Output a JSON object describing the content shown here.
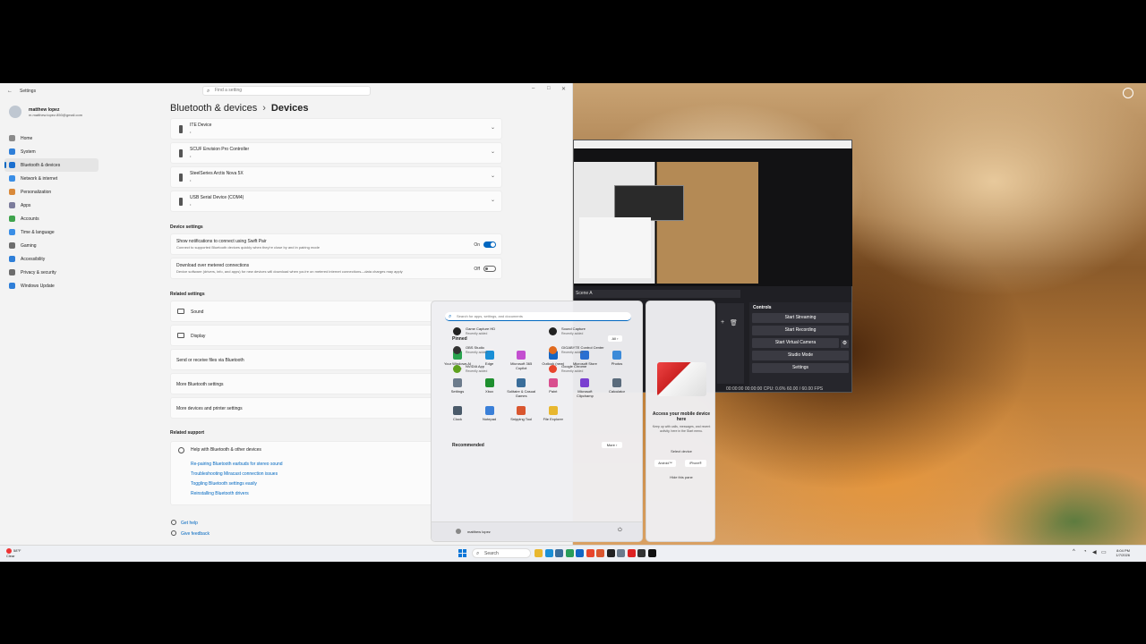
{
  "settings": {
    "title": "Settings",
    "search_placeholder": "Find a setting",
    "user": {
      "name": "matthew lopez",
      "email": "m.matthew.lopez.850@gmail.com"
    },
    "nav": [
      {
        "label": "Home",
        "icon": "home-icon",
        "color": "#8a8a8a"
      },
      {
        "label": "System",
        "icon": "system-icon",
        "color": "#2f7fd8"
      },
      {
        "label": "Bluetooth & devices",
        "icon": "bluetooth-icon",
        "color": "#1a6fcf"
      },
      {
        "label": "Network & internet",
        "icon": "network-icon",
        "color": "#3a8ee6"
      },
      {
        "label": "Personalization",
        "icon": "brush-icon",
        "color": "#d9893a"
      },
      {
        "label": "Apps",
        "icon": "apps-icon",
        "color": "#7c7c9c"
      },
      {
        "label": "Accounts",
        "icon": "accounts-icon",
        "color": "#3fa34d"
      },
      {
        "label": "Time & language",
        "icon": "globe-icon",
        "color": "#3a8ee6"
      },
      {
        "label": "Gaming",
        "icon": "gaming-icon",
        "color": "#6d6d6d"
      },
      {
        "label": "Accessibility",
        "icon": "accessibility-icon",
        "color": "#2f7fd8"
      },
      {
        "label": "Privacy & security",
        "icon": "shield-icon",
        "color": "#6d6d6d"
      },
      {
        "label": "Windows Update",
        "icon": "update-icon",
        "color": "#2f7fd8"
      }
    ],
    "breadcrumb": {
      "parent": "Bluetooth & devices",
      "separator": "›",
      "current": "Devices"
    },
    "devices": [
      {
        "name": "ITE Device",
        "sub": "•"
      },
      {
        "name": "SCUF Envision Pro Controller",
        "sub": "•"
      },
      {
        "name": "SteelSeries Arctis Nova 5X",
        "sub": "•"
      },
      {
        "name": "USB Serial Device (COM4)",
        "sub": "•"
      }
    ],
    "device_settings_title": "Device settings",
    "swift_pair": {
      "title": "Show notifications to connect using Swift Pair",
      "desc": "Connect to supported Bluetooth devices quickly when they're close by and in pairing mode",
      "state": "On"
    },
    "metered": {
      "title": "Download over metered connections",
      "desc": "Device software (drivers, info, and apps) for new devices will download when you're on metered internet connections—data charges may apply",
      "state": "Off"
    },
    "related_settings_title": "Related settings",
    "related": [
      "Sound",
      "Display",
      "Send or receive files via Bluetooth",
      "More Bluetooth settings",
      "More devices and printer settings"
    ],
    "related_support_title": "Related support",
    "support": {
      "head": "Help with Bluetooth & other devices",
      "links": [
        "Re-pairing Bluetooth earbuds for stereo sound",
        "Troubleshooting Miracast connection issues",
        "Toggling Bluetooth settings easily",
        "Reinstalling Bluetooth drivers"
      ]
    },
    "footer": [
      "Get help",
      "Give feedback"
    ]
  },
  "obs": {
    "scene_label": "Scene A",
    "controls_title": "Controls",
    "buttons": [
      "Start Streaming",
      "Start Recording",
      "Start Virtual Camera",
      "Studio Mode",
      "Settings"
    ],
    "status": "00:00:00   00:00:00   CPU: 0.6%   60.00 / 60.00 FPS"
  },
  "start": {
    "search_placeholder": "Search for apps, settings, and documents",
    "pinned_title": "Pinned",
    "all_label": "All  ›",
    "pinned": [
      {
        "label": "Your Windows AI Apps",
        "color": "#2aa44f"
      },
      {
        "label": "Edge",
        "color": "#1a8fd6"
      },
      {
        "label": "Microsoft 365 Copilot",
        "color": "#c34fd0"
      },
      {
        "label": "Outlook (new)",
        "color": "#1466c4"
      },
      {
        "label": "Microsoft Store",
        "color": "#2a6fd1"
      },
      {
        "label": "Photos",
        "color": "#3b8ad8"
      },
      {
        "label": "Settings",
        "color": "#6c7b8c"
      },
      {
        "label": "Xbox",
        "color": "#1e8f2f"
      },
      {
        "label": "Solitaire & Casual Games",
        "color": "#3a6d9a"
      },
      {
        "label": "Paint",
        "color": "#d94f8f"
      },
      {
        "label": "Microsoft Clipchamp",
        "color": "#7a3fd0"
      },
      {
        "label": "Calculator",
        "color": "#5a6b7c"
      },
      {
        "label": "Clock",
        "color": "#4a5a6a"
      },
      {
        "label": "Notepad",
        "color": "#3a7fd8"
      },
      {
        "label": "Snipping Tool",
        "color": "#d9562f"
      },
      {
        "label": "File Explorer",
        "color": "#e8b72f"
      }
    ],
    "recommended_title": "Recommended",
    "more_label": "More  ›",
    "recommended": [
      {
        "name": "Game Capture HD",
        "sub": "Recently added",
        "color": "#222"
      },
      {
        "name": "Sound Capture",
        "sub": "Recently added",
        "color": "#222"
      },
      {
        "name": "OBS Studio",
        "sub": "Recently added",
        "color": "#333"
      },
      {
        "name": "GIGABYTE Control Center",
        "sub": "Recently added",
        "color": "#e06a1f"
      },
      {
        "name": "NVIDIA App",
        "sub": "Recently added",
        "color": "#5ea11e"
      },
      {
        "name": "Google Chrome",
        "sub": "Recently added",
        "color": "#e8452c"
      }
    ],
    "user": "matthew lopez"
  },
  "phone": {
    "title": "Access your mobile device here",
    "sub": "Keep up with calls, messages, and recent activity, here in the Start menu.",
    "select": "Select device",
    "android": "Android™",
    "iphone": "iPhone®",
    "hide": "Hide this pane"
  },
  "taskbar": {
    "weather_temp": "58°F",
    "weather_desc": "Clear",
    "search_label": "Search",
    "time": "8:04 PM",
    "date": "1/7/2026",
    "apps": [
      "#e8b72f",
      "#1a8fd6",
      "#3a6d9a",
      "#2a9d5a",
      "#1466c4",
      "#e8452c",
      "#d9562f",
      "#222",
      "#6c7b8c",
      "#d22",
      "#333",
      "#111"
    ]
  }
}
